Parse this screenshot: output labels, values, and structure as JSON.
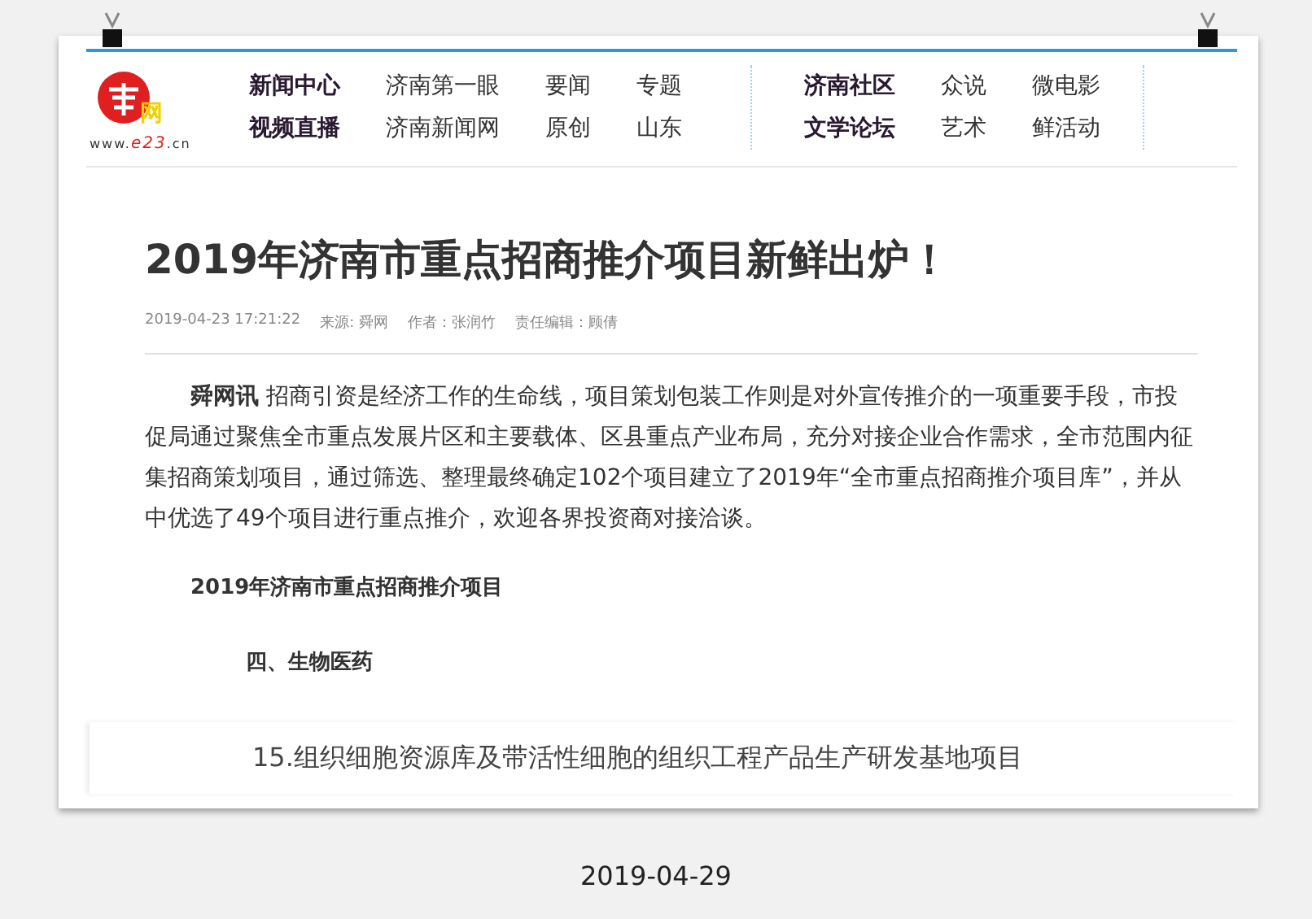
{
  "logo": {
    "mark": "网",
    "url_prefix": "www.",
    "url_brand": "e23",
    "url_suffix": ".cn"
  },
  "nav_groups": [
    {
      "rows": [
        {
          "heading": "新闻中心",
          "links": [
            "济南第一眼",
            "要闻",
            "专题"
          ]
        },
        {
          "heading": "视频直播",
          "links": [
            "济南新闻网",
            "原创",
            "山东"
          ]
        }
      ]
    },
    {
      "rows": [
        {
          "heading": "济南社区",
          "links": [
            "众说",
            "微电影"
          ]
        },
        {
          "heading": "文学论坛",
          "links": [
            "艺术",
            "鲜活动"
          ]
        }
      ]
    }
  ],
  "article": {
    "title": "2019年济南市重点招商推介项目新鲜出炉！",
    "meta": [
      "2019-04-23 17:21:22",
      "来源: 舜网",
      "作者：张润竹",
      "责任编辑：顾倩"
    ],
    "lead": "**舜网讯** 招商引资是经济工作的生命线，项目策划包装工作则是对外宣传推介的一项重要手段，市投促局通过聚焦全市重点发展片区和主要载体、区县重点产业布局，充分对接企业合作需求，全市范围内征集招商策划项目，通过筛选、整理最终确定102个项目建立了2019年“全市重点招商推介项目库”，并从中优选了49个项目进行重点推介，欢迎各界投资商对接洽谈。",
    "subheading": "2019年济南市重点招商推介项目",
    "section": "四、生物医药"
  },
  "highlight": "15.组织细胞资源库及带活性细胞的组织工程产品生产研发基地项目",
  "caption": "2019-04-29"
}
